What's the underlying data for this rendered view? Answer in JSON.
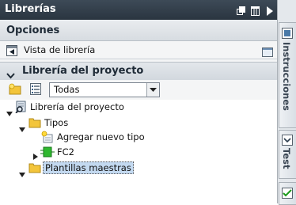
{
  "panel": {
    "title": "Librerías",
    "options_header": "Opciones",
    "library_view_label": "Vista de librería",
    "project_library_header": "Librería del proyecto",
    "filter": {
      "selected": "Todas"
    },
    "tree": {
      "root": "Librería del proyecto",
      "types": "Tipos",
      "add_type": "Agregar nuevo tipo",
      "fc2": "FC2",
      "master_templates": "Plantillas maestras"
    }
  },
  "side_tabs": {
    "instructions": "Instrucciones",
    "test": "Test"
  },
  "colors": {
    "titlebar": "#2f3b46",
    "selection": "#c3d9f0",
    "folder": "#f3c53b"
  }
}
